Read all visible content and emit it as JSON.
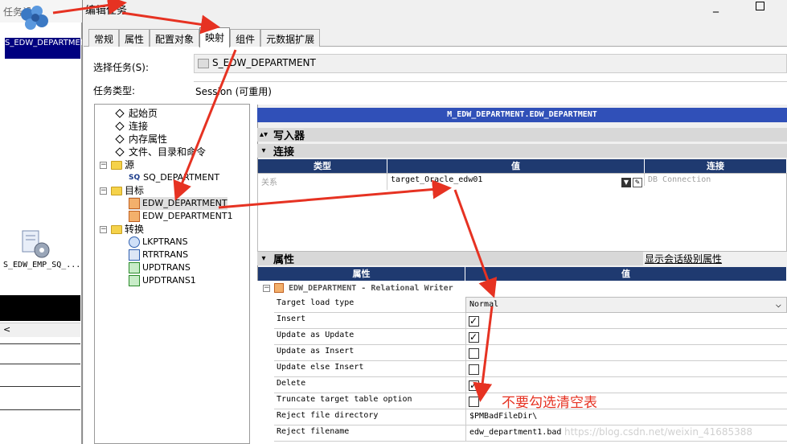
{
  "background": {
    "title": "任务设计",
    "task1_label": "S_EDW_DEPARTMENT",
    "task2_label": "S_EDW_EMP_SQ_...",
    "scroll_left_glyph": "<"
  },
  "dialog": {
    "title": "编辑任务",
    "min_glyph": "_",
    "tabs": [
      {
        "label": "常规"
      },
      {
        "label": "属性"
      },
      {
        "label": "配置对象"
      },
      {
        "label": "映射",
        "active": true
      },
      {
        "label": "组件"
      },
      {
        "label": "元数据扩展"
      }
    ],
    "select_task_label": "选择任务(S):",
    "select_task_value": "S_EDW_DEPARTMENT",
    "task_type_label": "任务类型:",
    "task_type_value": "Session (可重用)"
  },
  "tree": {
    "items": [
      {
        "label": "起始页"
      },
      {
        "label": "连接"
      },
      {
        "label": "内存属性"
      },
      {
        "label": "文件、目录和命令"
      },
      {
        "label": "源"
      },
      {
        "label": "SQ_DEPARTMENT"
      },
      {
        "label": "目标"
      },
      {
        "label": "EDW_DEPARTMENT"
      },
      {
        "label": "EDW_DEPARTMENT1"
      },
      {
        "label": "转换"
      },
      {
        "label": "LKPTRANS"
      },
      {
        "label": "RTRTRANS"
      },
      {
        "label": "UPDTRANS"
      },
      {
        "label": "UPDTRANS1"
      }
    ]
  },
  "right_pane": {
    "mapping_header": "M_EDW_DEPARTMENT.EDW_DEPARTMENT",
    "writer_section": "写入器",
    "connection_section": "连接",
    "conn_headers": [
      "类型",
      "值",
      "连接"
    ],
    "conn_row": {
      "type": "关系",
      "value": "target_Oracle_edw01",
      "connection": "DB Connection"
    },
    "props_section": "属性",
    "show_session_props": "显示会话级别属性",
    "props_headers": [
      "属性",
      "值"
    ],
    "group_label": "EDW_DEPARTMENT - Relational Writer",
    "properties": [
      {
        "name": "Target load type",
        "value": "Normal",
        "kind": "select"
      },
      {
        "name": "Insert",
        "checked": true,
        "kind": "check"
      },
      {
        "name": "Update as Update",
        "checked": true,
        "kind": "check"
      },
      {
        "name": "Update as Insert",
        "checked": false,
        "kind": "check"
      },
      {
        "name": "Update else Insert",
        "checked": false,
        "kind": "check"
      },
      {
        "name": "Delete",
        "checked": true,
        "kind": "check"
      },
      {
        "name": "Truncate target table option",
        "checked": false,
        "kind": "check"
      },
      {
        "name": "Reject file directory",
        "value": "$PMBadFileDir\\",
        "kind": "text"
      },
      {
        "name": "Reject filename",
        "value": "edw_department1.bad",
        "kind": "text"
      }
    ]
  },
  "annotation": {
    "text": "不要勾选清空表",
    "color": "#e63222"
  },
  "watermark": "https://blog.csdn.net/weixin_41685388"
}
